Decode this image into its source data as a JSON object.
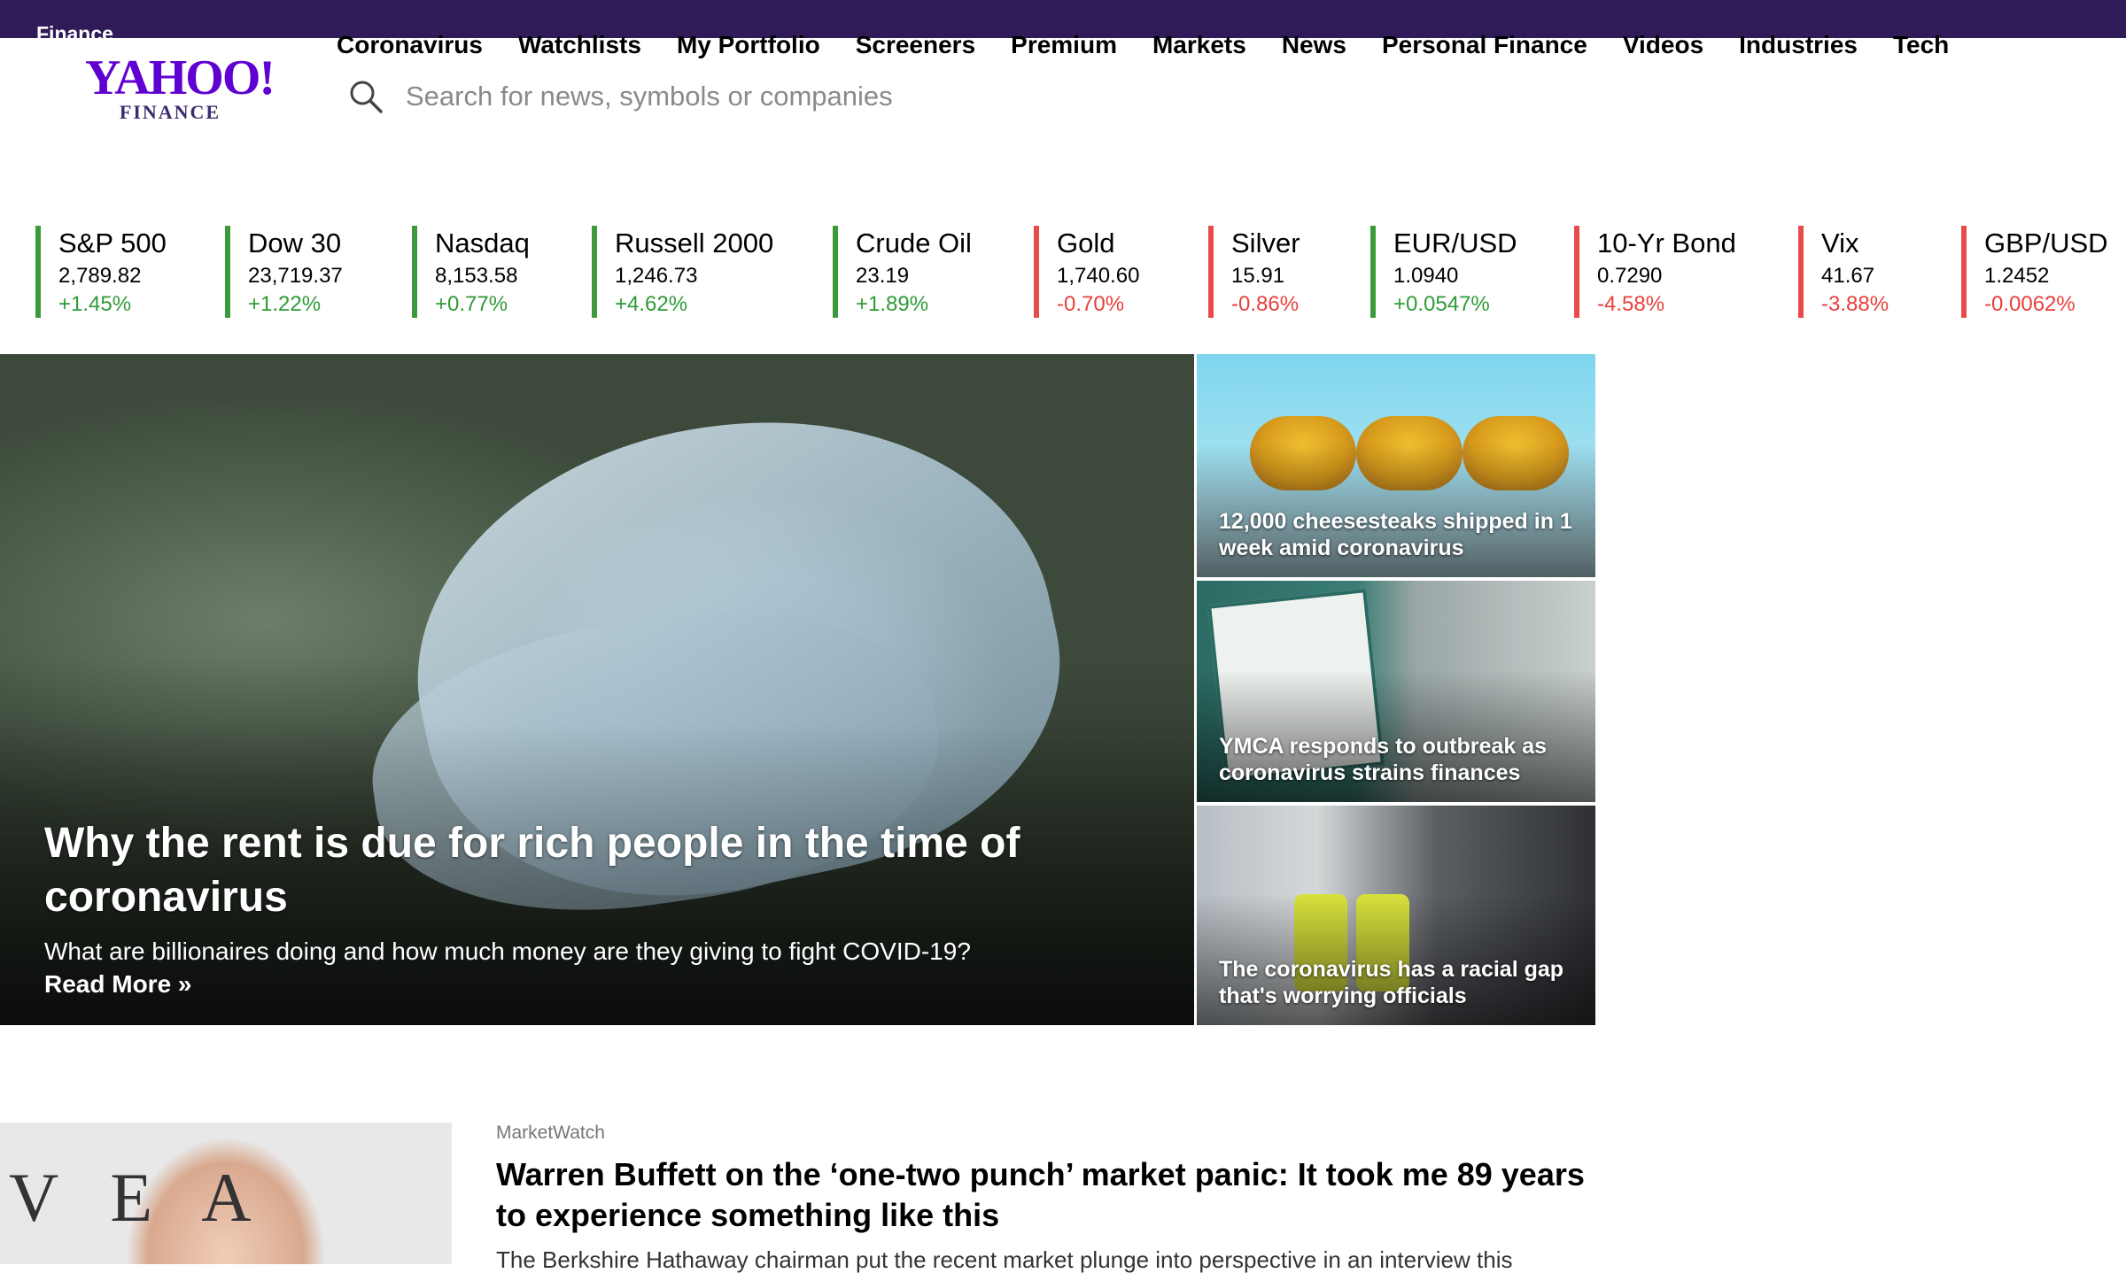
{
  "topbar": {
    "label": "Finance"
  },
  "logo": {
    "yahoo": "YAHOO!",
    "finance": "FINANCE"
  },
  "nav": [
    "Coronavirus",
    "Watchlists",
    "My Portfolio",
    "Screeners",
    "Premium",
    "Markets",
    "News",
    "Personal Finance",
    "Videos",
    "Industries",
    "Tech"
  ],
  "search": {
    "placeholder": "Search for news, symbols or companies"
  },
  "ticker": [
    {
      "name": "S&P 500",
      "price": "2,789.82",
      "change": "+1.45%",
      "dir": "up"
    },
    {
      "name": "Dow 30",
      "price": "23,719.37",
      "change": "+1.22%",
      "dir": "up"
    },
    {
      "name": "Nasdaq",
      "price": "8,153.58",
      "change": "+0.77%",
      "dir": "up"
    },
    {
      "name": "Russell 2000",
      "price": "1,246.73",
      "change": "+4.62%",
      "dir": "up"
    },
    {
      "name": "Crude Oil",
      "price": "23.19",
      "change": "+1.89%",
      "dir": "up"
    },
    {
      "name": "Gold",
      "price": "1,740.60",
      "change": "-0.70%",
      "dir": "down"
    },
    {
      "name": "Silver",
      "price": "15.91",
      "change": "-0.86%",
      "dir": "down"
    },
    {
      "name": "EUR/USD",
      "price": "1.0940",
      "change": "+0.0547%",
      "dir": "up"
    },
    {
      "name": "10-Yr Bond",
      "price": "0.7290",
      "change": "-4.58%",
      "dir": "down"
    },
    {
      "name": "Vix",
      "price": "41.67",
      "change": "-3.88%",
      "dir": "down"
    },
    {
      "name": "GBP/USD",
      "price": "1.2452",
      "change": "-0.0062%",
      "dir": "down"
    }
  ],
  "hero": {
    "title": "Why the rent is due for rich people in the time of coronavirus",
    "summary": "What are billionaires doing and how much money are they giving to fight COVID-19?",
    "read_more": "Read More »"
  },
  "side_stories": [
    {
      "caption": "12,000 cheesesteaks shipped in 1 week amid coronavirus"
    },
    {
      "caption": "YMCA responds to outbreak as coronavirus strains finances"
    },
    {
      "caption": "The coronavirus has a racial gap that's worrying officials"
    }
  ],
  "story": {
    "source": "MarketWatch",
    "headline": "Warren Buffett on the ‘one-two punch’ market panic: It took me 89 years to experience something like this",
    "excerpt": "The Berkshire Hathaway chairman put the recent market plunge into perspective in an interview this"
  },
  "colors": {
    "brand": "#5f01d1",
    "topbar": "#2e1b58",
    "up": "#2f9b37",
    "down": "#e8403c"
  }
}
